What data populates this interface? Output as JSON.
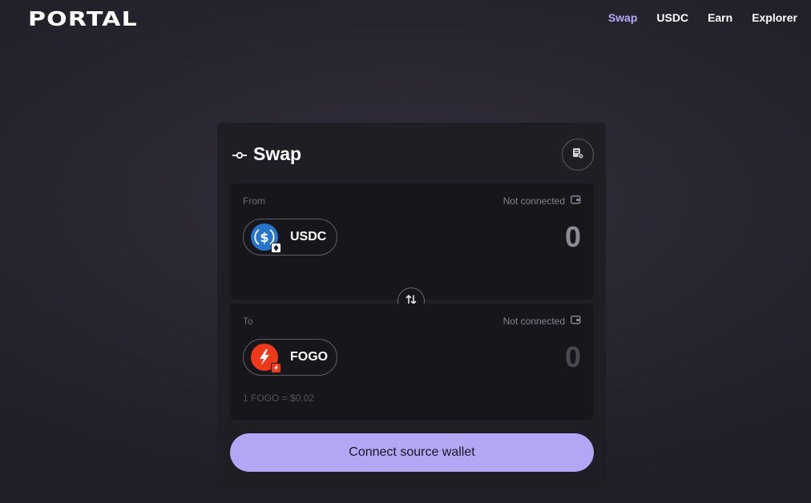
{
  "header": {
    "logo": "PORTAL",
    "nav": [
      "Swap",
      "USDC",
      "Earn",
      "Explorer"
    ],
    "active_nav": "Swap"
  },
  "swap": {
    "title": "Swap",
    "from": {
      "label": "From",
      "status": "Not connected",
      "token": "USDC",
      "amount": "0"
    },
    "to": {
      "label": "To",
      "status": "Not connected",
      "token": "FOGO",
      "amount": "0",
      "rate": "1 FOGO = $0.02"
    },
    "cta_label": "Connect source wallet"
  },
  "colors": {
    "accent": "#b3a6f4",
    "active_nav": "#b6a9f6",
    "usdc": "#2775ca",
    "fogo": "#ee3a1a"
  },
  "icons": [
    "commit-icon",
    "receipt-settings-icon",
    "wallet-icon",
    "usdc-logo",
    "fogo-logo",
    "swap-arrows-icon"
  ]
}
